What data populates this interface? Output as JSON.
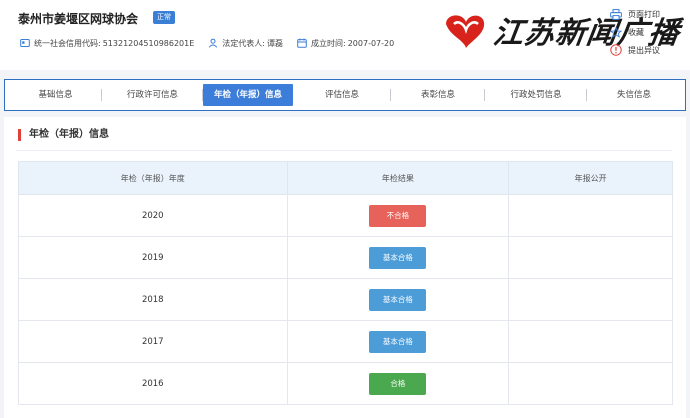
{
  "header": {
    "org_name": "泰州市姜堰区网球协会",
    "status": "正常",
    "credit_code_label": "统一社会信用代码:",
    "credit_code": "51321204510986201E",
    "legal_rep_label": "法定代表人:",
    "legal_rep": "谭磊",
    "founded_label": "成立时间:",
    "founded": "2007-07-20"
  },
  "watermark": {
    "text": "江苏新闻广播"
  },
  "side_actions": [
    {
      "label": "页面打印",
      "icon": "printer-icon"
    },
    {
      "label": "收藏",
      "icon": "star-icon"
    },
    {
      "label": "提出异议",
      "icon": "info-icon"
    }
  ],
  "tabs": [
    {
      "label": "基础信息"
    },
    {
      "label": "行政许可信息"
    },
    {
      "label": "年检（年报）信息"
    },
    {
      "label": "评估信息"
    },
    {
      "label": "表彰信息"
    },
    {
      "label": "行政处罚信息"
    },
    {
      "label": "失信信息"
    }
  ],
  "section": {
    "title": "年检（年报）信息"
  },
  "table": {
    "headers": [
      "年检（年报）年度",
      "年检结果",
      "年报公开"
    ],
    "rows": [
      {
        "year": "2020",
        "result": "不合格",
        "public": ""
      },
      {
        "year": "2019",
        "result": "基本合格",
        "public": ""
      },
      {
        "year": "2018",
        "result": "基本合格",
        "public": ""
      },
      {
        "year": "2017",
        "result": "基本合格",
        "public": ""
      },
      {
        "year": "2016",
        "result": "合格",
        "public": ""
      }
    ]
  },
  "colors": {
    "accent": "#3b7dd8",
    "fail": "#e6625a",
    "basic_pass": "#4c9cd8",
    "pass": "#4aa84e",
    "section_marker": "#e0413a"
  }
}
